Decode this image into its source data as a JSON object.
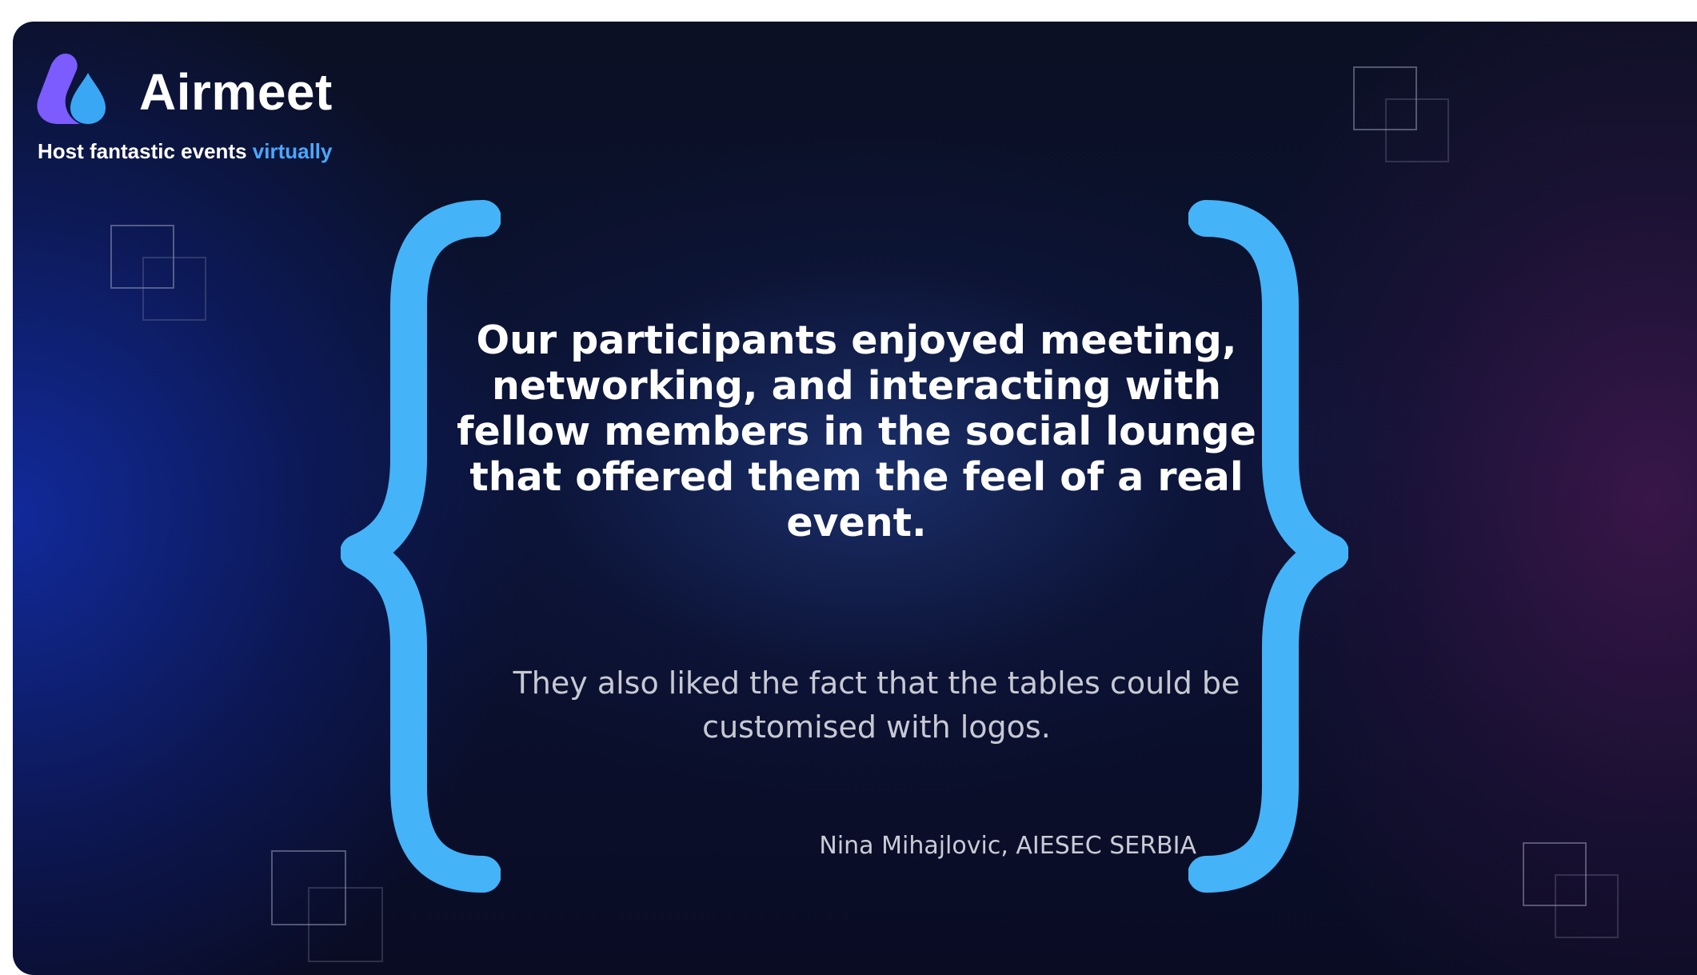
{
  "brand": {
    "name": "Airmeet",
    "tagline_main": "Host fantastic events",
    "tagline_accent": "virtually",
    "logo_icon": "airmeet-drop-logo-icon",
    "colors": {
      "accent_blue": "#4aa8ff",
      "logo_purple": "#7c5cff",
      "logo_blue": "#3aa7f5",
      "brace_blue": "#45b3f7"
    }
  },
  "testimonial": {
    "quote": "Our participants enjoyed meeting, networking, and interacting with fellow members in the social lounge that offered them the feel of a real event.",
    "detail": "They also liked the fact that the tables could be customised with logos.",
    "author": "Nina Mihajlovic, AIESEC SERBIA"
  }
}
